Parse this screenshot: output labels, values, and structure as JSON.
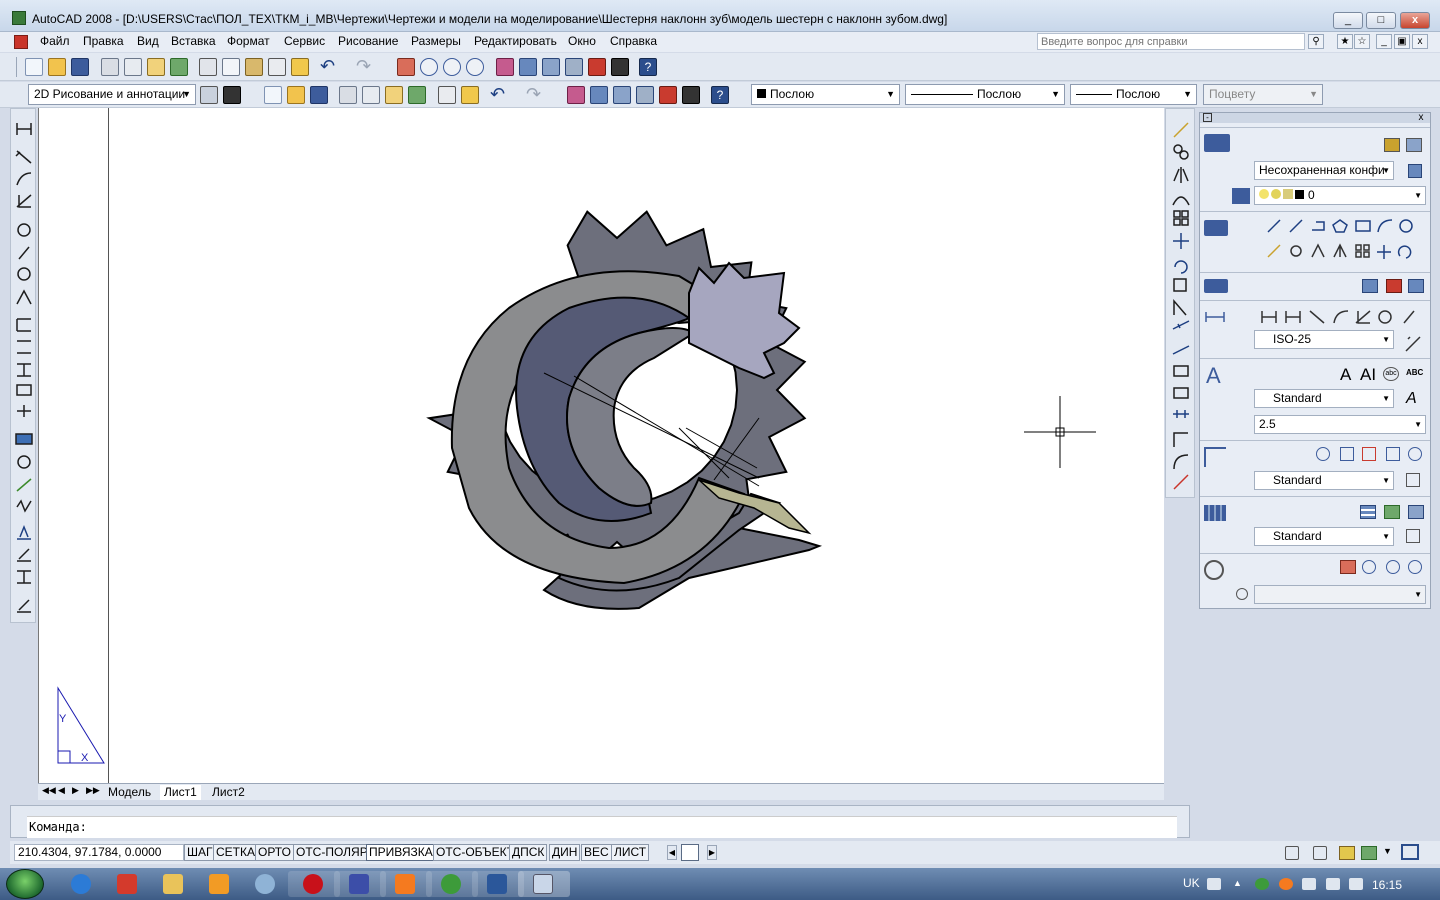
{
  "window": {
    "title": "AutoCAD 2008 - [D:\\USERS\\Стас\\ПОЛ_ТЕХ\\ТКМ_i_MB\\Чертежи\\Чертежи и модели на моделирование\\Шестерня наклонн зуб\\модель шестерн с наклонн зубом.dwg]",
    "minimize": "_",
    "maximize": "□",
    "close": "x"
  },
  "menu": {
    "items": [
      "Файл",
      "Правка",
      "Вид",
      "Вставка",
      "Формат",
      "Сервис",
      "Рисование",
      "Размеры",
      "Редактировать",
      "Окно",
      "Справка"
    ],
    "help_placeholder": "Введите вопрос для справки"
  },
  "toolbar": {
    "workspace": "2D Рисование и аннотации",
    "color": "Послою",
    "linetype": "Послою",
    "lineweight": "Послою",
    "plotstyle": "Поцвету"
  },
  "panel": {
    "layer_state": "Несохраненная конфи",
    "layer_current": "0",
    "dim_style": "ISO-25",
    "text_style": "Standard",
    "text_height": "2.5",
    "multileader_style": "Standard",
    "table_style": "Standard",
    "text_big": "A",
    "text_icon_a": "A",
    "text_icon_al": "AI",
    "abc_icon": "ABC"
  },
  "tabs": {
    "model": "Модель",
    "layout1": "Лист1",
    "layout2": "Лист2"
  },
  "command": {
    "prompt": "Команда:"
  },
  "status": {
    "coords": "210.4304, 97.1784, 0.0000",
    "toggles": [
      "ШАГ",
      "СЕТКА",
      "ОРТО",
      "ОТС-ПОЛЯР",
      "ПРИВЯЗКА",
      "ОТС-ОБЪЕКТ",
      "ДПСК",
      "ДИН",
      "ВЕС",
      "ЛИСТ"
    ],
    "active_toggles": [
      "ПРИВЯЗКА"
    ]
  },
  "ucs": {
    "y_label": "Y",
    "x_label": "X"
  },
  "taskbar": {
    "language": "UK",
    "clock": "16:15"
  },
  "colors": {
    "gear_body": "#6d6f7c",
    "gear_light": "#8b8c8e",
    "gear_inner": "#555a75",
    "gear_highlight": "#a6a6bf",
    "gear_accent": "#b6b592"
  }
}
